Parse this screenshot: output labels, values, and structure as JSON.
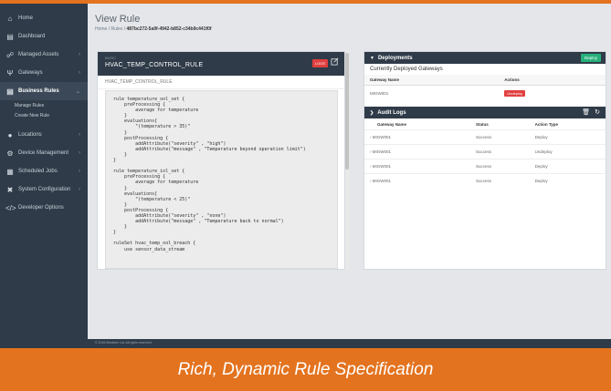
{
  "sidebar": {
    "items": [
      {
        "label": "Home",
        "icon": "home-icon",
        "chev": false
      },
      {
        "label": "Dashboard",
        "icon": "chart-icon",
        "chev": false
      },
      {
        "label": "Managed Assets",
        "icon": "assets-icon",
        "chev": true
      },
      {
        "label": "Gateways",
        "icon": "gateway-icon",
        "chev": true
      },
      {
        "label": "Business Rules",
        "icon": "rules-icon",
        "chev": true,
        "active": true
      }
    ],
    "subitems": [
      "Manage Rules",
      "Create New Rule"
    ],
    "items2": [
      {
        "label": "Locations",
        "icon": "location-icon"
      },
      {
        "label": "Device Management",
        "icon": "device-icon"
      },
      {
        "label": "Scheduled Jobs",
        "icon": "calendar-icon"
      },
      {
        "label": "System Configuration",
        "icon": "wrench-icon"
      },
      {
        "label": "Developer Options",
        "icon": "code-icon"
      }
    ]
  },
  "header": {
    "title": "View Rule",
    "breadcrumb_home": "Home",
    "breadcrumb_rules": "Rules",
    "breadcrumb_id": "487bc272-5a9f-4942-b852-c34b9c441f0f"
  },
  "rule": {
    "type_label": "BASIC",
    "name": "HVAC_TEMP_CONTROL_RULE",
    "logs_label": "LOGS",
    "subtitle": "HVAC_TEMP_CONTROL_RULE",
    "code": "rule temperature_ool_set {\n    preProcessing {\n        average for temperature\n    }\n    evaluations{\n        \"(temperature > 35)\"\n    }\n    postProcessing {\n        addAttribute(\"severity\" , \"high\")\n        addAttribute(\"message\" , \"Temperature beyond operation limit\")\n    }\n}\n\nrule temperature_iol_set {\n    preProcessing {\n        average for temperature\n    }\n    evaluations{\n        \"(temperature < 25)\"\n    }\n    postProcessing {\n        addAttribute(\"severity\" , \"none\")\n        addAttribute(\"message\" , \"Temperature back to normal\")\n    }\n}\n\nruleSet hvac_temp_ool_breach {\n    use sensor_data_stream"
  },
  "deployments": {
    "title": "Deployments",
    "deploy_label": "Deploy",
    "caption": "Currently Deployed Gateways",
    "headers": [
      "Gateway Name",
      "Actions"
    ],
    "rows": [
      {
        "gateway": "MIGW001",
        "action": "Undeploy"
      }
    ]
  },
  "audit": {
    "title": "Audit Logs",
    "headers": [
      "Gateway Name",
      "Status",
      "Action Type"
    ],
    "rows": [
      {
        "gateway": "MIGW001",
        "status": "Success",
        "action": "Deploy"
      },
      {
        "gateway": "MIGW001",
        "status": "Success",
        "action": "Undeploy"
      },
      {
        "gateway": "MIGW001",
        "status": "Success",
        "action": "Deploy"
      },
      {
        "gateway": "MIGW001",
        "status": "Success",
        "action": "Deploy"
      }
    ]
  },
  "footer": "© 2016 Mindtree Ltd. All rights reserved.",
  "caption": "Rich, Dynamic Rule Specification"
}
